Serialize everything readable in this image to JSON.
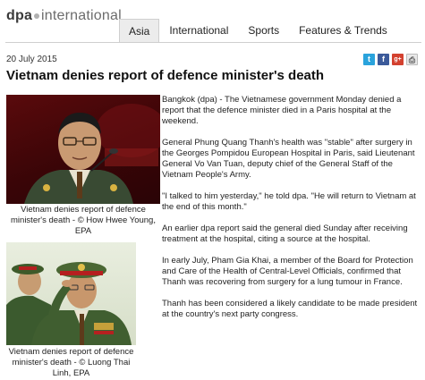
{
  "header": {
    "logo_brand": "dpa",
    "logo_rest": "international",
    "tabs": [
      {
        "label": "Asia",
        "active": true
      },
      {
        "label": "International",
        "active": false
      },
      {
        "label": "Sports",
        "active": false
      },
      {
        "label": "Features & Trends",
        "active": false
      }
    ]
  },
  "share": {
    "icons": [
      "twitter-icon",
      "facebook-icon",
      "google-plus-icon",
      "print-icon"
    ],
    "twitter": "t",
    "facebook": "f",
    "google_plus": "g+",
    "print": "⎙"
  },
  "article": {
    "date": "20 July 2015",
    "title": "Vietnam denies report of defence minister's death",
    "paragraphs": [
      "Bangkok (dpa) - The Vietnamese government Monday denied a report that the defence minister died in a Paris hospital at the weekend.",
      "General Phung Quang Thanh's health was \"stable\" after surgery in the Georges Pompidou European Hospital in Paris, said Lieutenant General Vo Van Tuan, deputy chief of the General Staff of the Vietnam People's Army.",
      "\"I talked to him yesterday,\" he told dpa. \"He will return to Vietnam at the end of this month.\"",
      "An earlier dpa report said the general died Sunday after receiving treatment at the hospital, citing a source at the hospital.",
      "In early July, Pham Gia Khai, a member of the Board for Protection and Care of the Health of Central-Level Officials, confirmed that Thanh was recovering from surgery for a lung tumour in France.",
      "Thanh has been considered a likely candidate to be made president at the country's next party congress."
    ],
    "photos": [
      {
        "caption": "Vietnam denies report of defence minister's death - © How Hwee Young, EPA"
      },
      {
        "caption": "Vietnam denies report of defence minister's death - © Luong Thai Linh, EPA"
      }
    ]
  }
}
